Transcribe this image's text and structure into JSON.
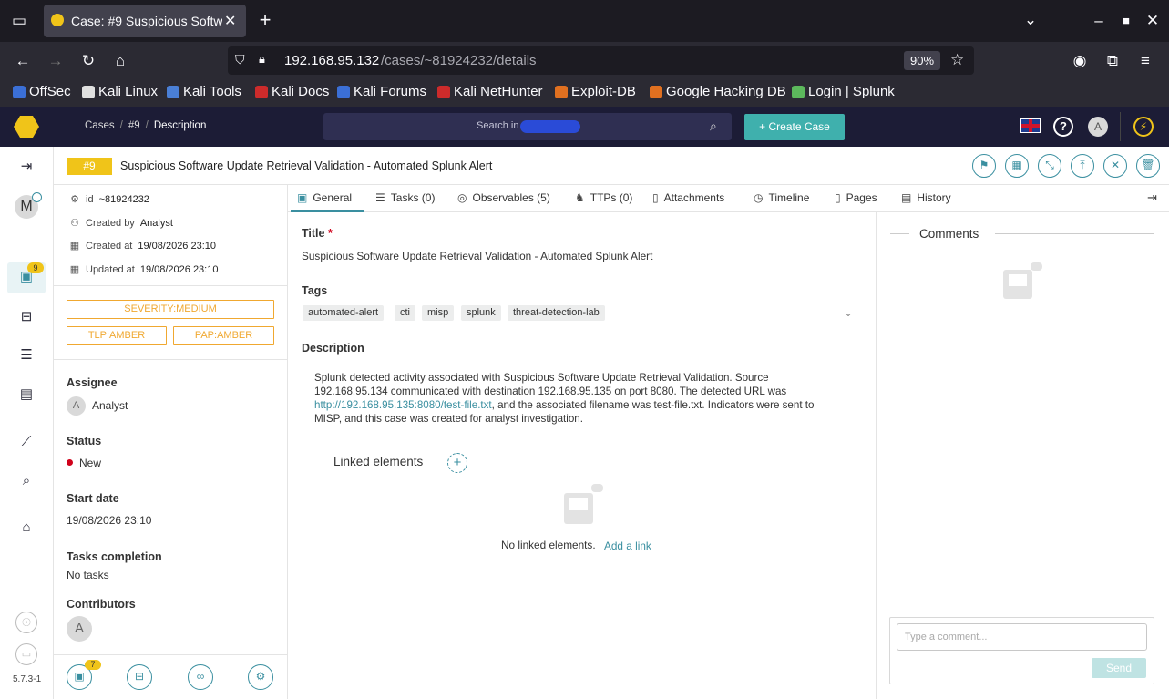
{
  "browser": {
    "tab_title": "Case: #9 Suspicious Softw",
    "url_host": "192.168.95.132",
    "url_path": "/cases/~81924232/details",
    "zoom": "90%",
    "bookmarks": [
      {
        "label": "OffSec",
        "color": "#3b6fd6"
      },
      {
        "label": "Kali Linux",
        "color": "#e0e0e0"
      },
      {
        "label": "Kali Tools",
        "color": "#4a7fd6"
      },
      {
        "label": "Kali Docs",
        "color": "#cc2b2b"
      },
      {
        "label": "Kali Forums",
        "color": "#3b6fd6"
      },
      {
        "label": "Kali NetHunter",
        "color": "#cc2b2b"
      },
      {
        "label": "Exploit-DB",
        "color": "#e07020"
      },
      {
        "label": "Google Hacking DB",
        "color": "#e07020"
      },
      {
        "label": "Login | Splunk",
        "color": "#5cb85c"
      }
    ]
  },
  "header": {
    "breadcrumb": [
      "Cases",
      "#9",
      "Description"
    ],
    "search_placeholder": "Search in",
    "create_case": "+ Create Case",
    "avatar_letter": "A"
  },
  "leftnav": {
    "org_letter": "M",
    "cases_badge": "9",
    "version": "5.7.3-1"
  },
  "case": {
    "number": "#9",
    "title": "Suspicious Software Update Retrieval Validation - Automated Splunk Alert",
    "id": "~81924232",
    "created_by_label": "Created by",
    "created_by": "Analyst",
    "created_at_label": "Created at",
    "created_at": "19/08/2026 23:10",
    "updated_at_label": "Updated at",
    "updated_at": "19/08/2026 23:10",
    "id_label": "id",
    "severity": "SEVERITY:MEDIUM",
    "tlp": "TLP:AMBER",
    "pap": "PAP:AMBER",
    "assignee_label": "Assignee",
    "assignee": "Analyst",
    "assignee_letter": "A",
    "status_label": "Status",
    "status": "New",
    "status_color": "#d0021b",
    "start_date_label": "Start date",
    "start_date": "19/08/2026 23:10",
    "tasks_completion_label": "Tasks completion",
    "tasks_completion": "No tasks",
    "contributors_label": "Contributors",
    "contributor_letter": "A",
    "bottom_badge": "7"
  },
  "tabs": [
    {
      "label": "General",
      "icon": "briefcase-icon"
    },
    {
      "label": "Tasks (0)",
      "icon": "list-icon"
    },
    {
      "label": "Observables (5)",
      "icon": "fingerprint-icon"
    },
    {
      "label": "TTPs (0)",
      "icon": "chess-icon"
    },
    {
      "label": "Attachments",
      "icon": "file-icon"
    },
    {
      "label": "Timeline",
      "icon": "clock-icon"
    },
    {
      "label": "Pages",
      "icon": "page-icon"
    },
    {
      "label": "History",
      "icon": "history-icon"
    }
  ],
  "general": {
    "title_label": "Title",
    "required_mark": "*",
    "title_value": "Suspicious Software Update Retrieval Validation - Automated Splunk Alert",
    "tags_label": "Tags",
    "tags": [
      "automated-alert",
      "cti",
      "misp",
      "splunk",
      "threat-detection-lab"
    ],
    "description_label": "Description",
    "description_part1": "Splunk detected activity associated with Suspicious Software Update Retrieval Validation. Source 192.168.95.134 communicated with destination 192.168.95.135 on port 8080. The detected URL was ",
    "description_link": "http://192.168.95.135:8080/test-file.txt",
    "description_part2": ", and the associated filename was test-file.txt. Indicators were sent to MISP, and this case was created for analyst investigation.",
    "linked_label": "Linked elements",
    "no_linked": "No linked elements.",
    "add_link": "Add a link"
  },
  "comments": {
    "title": "Comments",
    "placeholder": "Type a comment...",
    "send": "Send"
  }
}
